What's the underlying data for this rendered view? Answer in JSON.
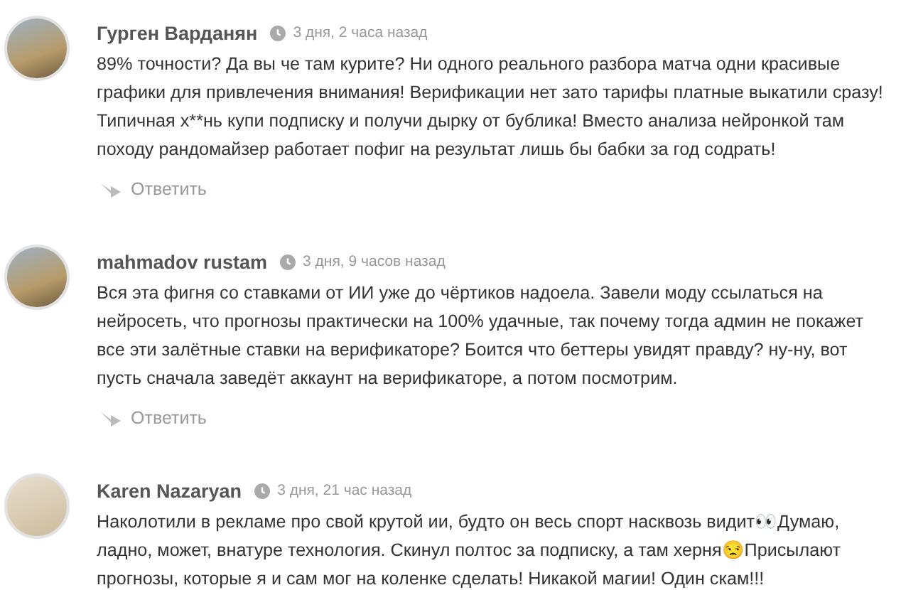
{
  "comments": [
    {
      "author": "Гурген Варданян",
      "time": "3 дня, 2 часа назад",
      "text": "89% точности? Да вы че там курите? Ни одного реального разбора матча одни красивые графики для привлечения внимания! Верификации нет зато тарифы платные выкатили сразу! Типичная х**нь купи подписку и получи дырку от бублика! Вместо анализа нейронкой там походу рандомайзер работает пофиг на результат лишь бы бабки за год содрать!",
      "reply": "Ответить"
    },
    {
      "author": "mahmadov rustam",
      "time": "3 дня, 9 часов назад",
      "text": "Вся эта фигня со ставками от ИИ уже до чёртиков надоела. Завели моду ссылаться на нейросеть, что прогнозы практически на 100% удачные, так почему тогда админ не покажет все эти залётные ставки на верификаторе? Боится что беттеры увидят правду? ну-ну, вот пусть сначала заведёт аккаунт на верификаторе, а потом посмотрим.",
      "reply": "Ответить"
    },
    {
      "author": "Karen Nazaryan",
      "time": "3 дня, 21 час назад",
      "text": "Наколотили в рекламе про свой крутой ии, будто он весь спорт насквозь видит👀Думаю, ладно, может, внатуре технология. Скинул полтос за подписку, а там херня😒Присылают прогнозы, которые я и сам мог на коленке сделать! Никакой магии! Один скам!!!"
    }
  ]
}
